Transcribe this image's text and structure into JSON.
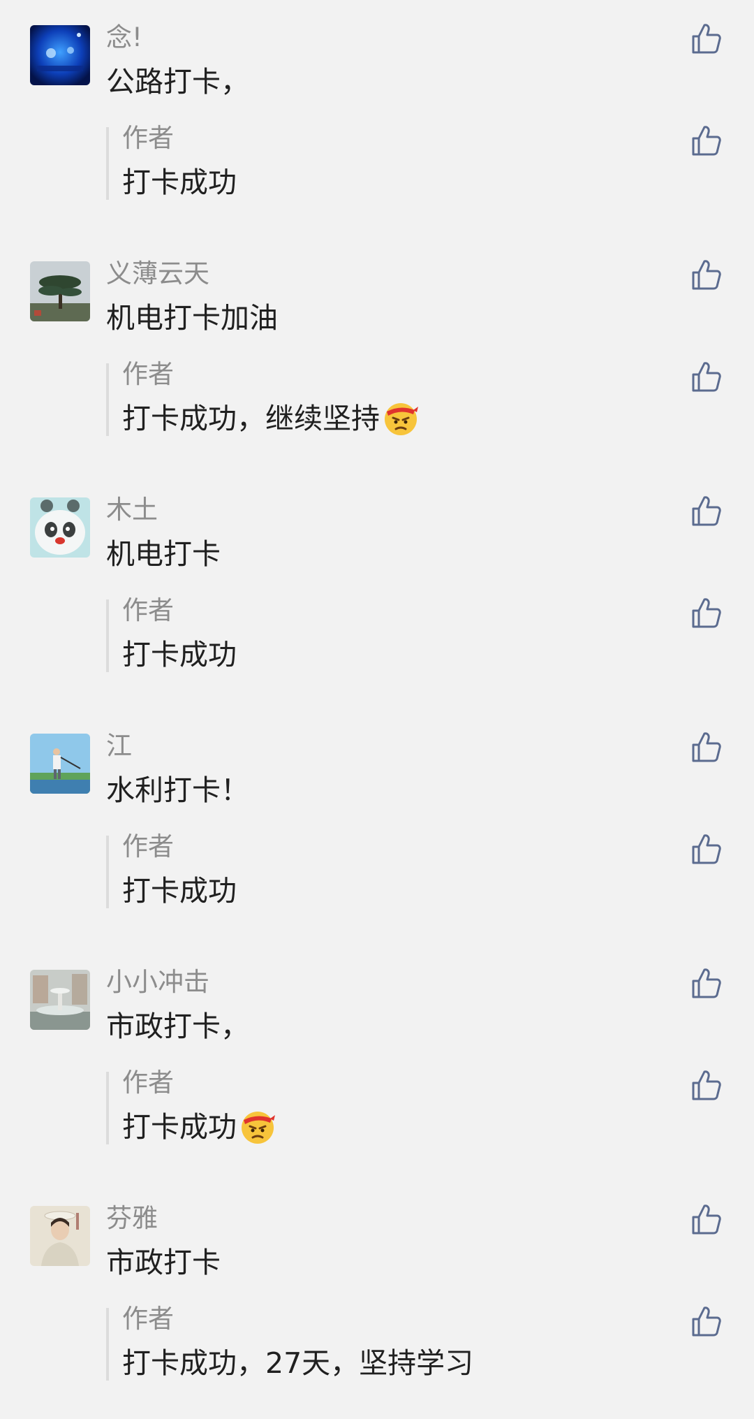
{
  "comments": [
    {
      "username": "念!",
      "text": "公路打卡，",
      "avatar": "blue-night-scene-avatar",
      "reply": {
        "author": "作者",
        "text": "打卡成功",
        "emoji": ""
      }
    },
    {
      "username": "义薄云天",
      "text": "机电打卡加油",
      "avatar": "pine-tree-avatar",
      "reply": {
        "author": "作者",
        "text": "打卡成功，继续坚持",
        "emoji": "determined-face-emoji"
      }
    },
    {
      "username": "木土",
      "text": "机电打卡",
      "avatar": "panda-avatar",
      "reply": {
        "author": "作者",
        "text": "打卡成功",
        "emoji": ""
      }
    },
    {
      "username": "江",
      "text": "水利打卡！",
      "avatar": "golfer-avatar",
      "reply": {
        "author": "作者",
        "text": "打卡成功",
        "emoji": ""
      }
    },
    {
      "username": "小小冲击",
      "text": "市政打卡，",
      "avatar": "fountain-avatar",
      "reply": {
        "author": "作者",
        "text": "打卡成功",
        "emoji": "determined-face-emoji"
      }
    },
    {
      "username": "芬雅",
      "text": "市政打卡",
      "avatar": "portrait-avatar",
      "reply": {
        "author": "作者",
        "text": "打卡成功，27天，坚持学习",
        "emoji": ""
      }
    }
  ],
  "colors": {
    "background": "#f2f2f2",
    "secondary_text": "#8c8c8c",
    "primary_text": "#202020",
    "like_icon": "#5b6b8f"
  }
}
